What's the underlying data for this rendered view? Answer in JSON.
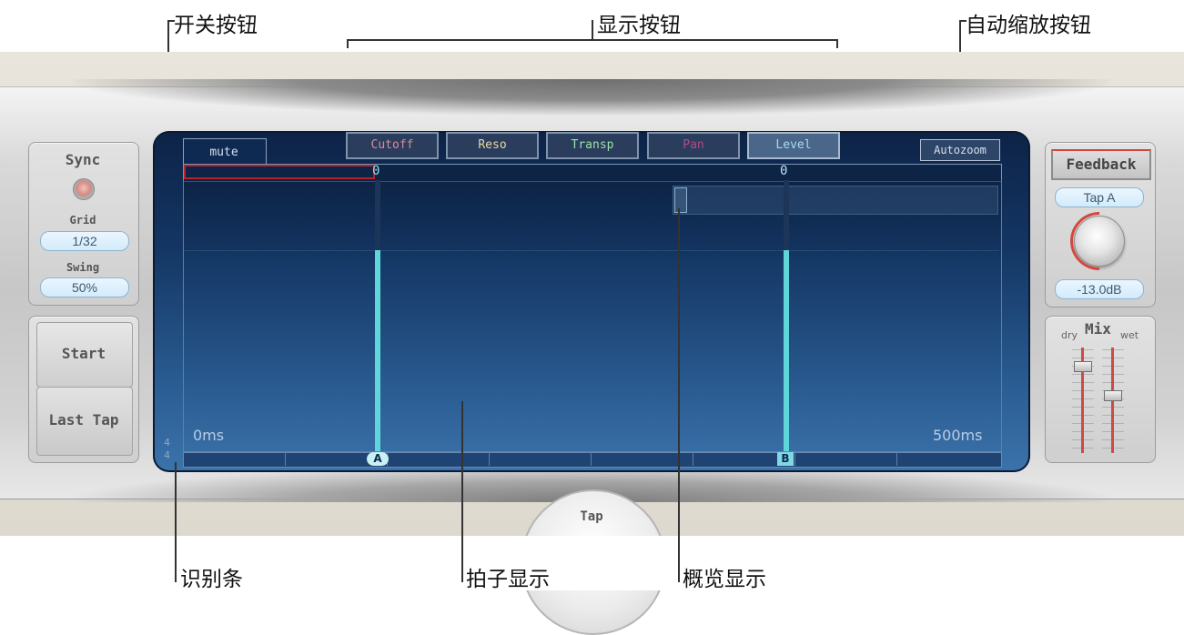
{
  "annotations": {
    "switch_button": "开关按钮",
    "display_buttons": "显示按钮",
    "autozoom_button": "自动缩放按钮",
    "identify_bar": "识别条",
    "beat_display": "拍子显示",
    "overview_display": "概览显示"
  },
  "sync_panel": {
    "title": "Sync",
    "grid_label": "Grid",
    "grid_value": "1/32",
    "swing_label": "Swing",
    "swing_value": "50%"
  },
  "tap_buttons": {
    "start": "Start",
    "last_tap": "Last Tap"
  },
  "screen": {
    "mute_tab": "mute",
    "display_buttons": [
      "Cutoff",
      "Reso",
      "Transp",
      "Pan",
      "Level"
    ],
    "display_button_colors": [
      "#e08a9a",
      "#e8d9a2",
      "#9de0a8",
      "#b04a86",
      "#a8dcf0"
    ],
    "active_display": "Level",
    "autozoom": "Autozoom",
    "time_start": "0ms",
    "time_end": "500ms",
    "signature_top": "4",
    "signature_bottom": "4",
    "tap_a_label": "A",
    "tap_b_label": "B",
    "tap_a_value": "0",
    "tap_b_value": "0",
    "tap_a_position": 0.23,
    "tap_b_position": 0.73,
    "tap_a_level": 0.74,
    "tap_b_level": 0.74,
    "accent_color": "#5fd6d9"
  },
  "right_panel": {
    "feedback": "Feedback",
    "tap_select": "Tap A",
    "level_value": "-13.0dB"
  },
  "mix_panel": {
    "title": "Mix",
    "dry": "dry",
    "wet": "wet"
  },
  "bottom": {
    "tap": "Tap"
  }
}
